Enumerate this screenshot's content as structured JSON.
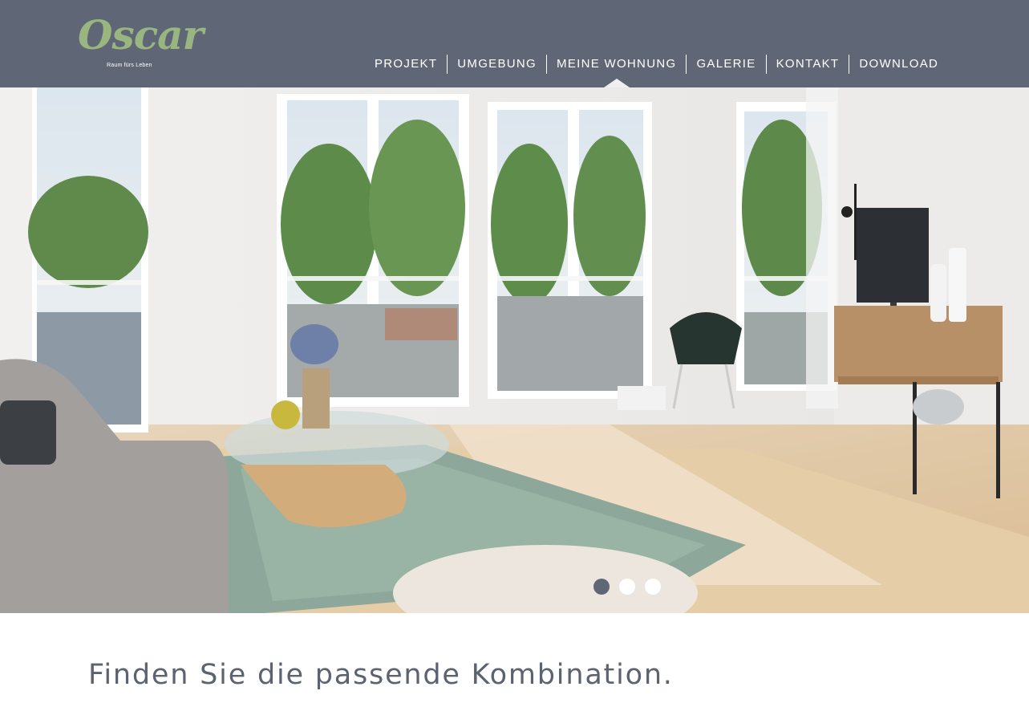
{
  "brand": {
    "logo_text": "Oscar",
    "tagline": "Raum fürs Leben",
    "logo_color": "#9ab57f"
  },
  "header": {
    "background": "#5f6776"
  },
  "nav": {
    "items": [
      {
        "label": "PROJEKT",
        "active": false
      },
      {
        "label": "UMGEBUNG",
        "active": false
      },
      {
        "label": "MEINE WOHNUNG",
        "active": true
      },
      {
        "label": "GALERIE",
        "active": false
      },
      {
        "label": "KONTAKT",
        "active": false
      },
      {
        "label": "DOWNLOAD",
        "active": false
      }
    ]
  },
  "slider": {
    "slide_count": 3,
    "active_index": 0
  },
  "intro": {
    "heading": "Finden Sie die passende Kombination."
  }
}
